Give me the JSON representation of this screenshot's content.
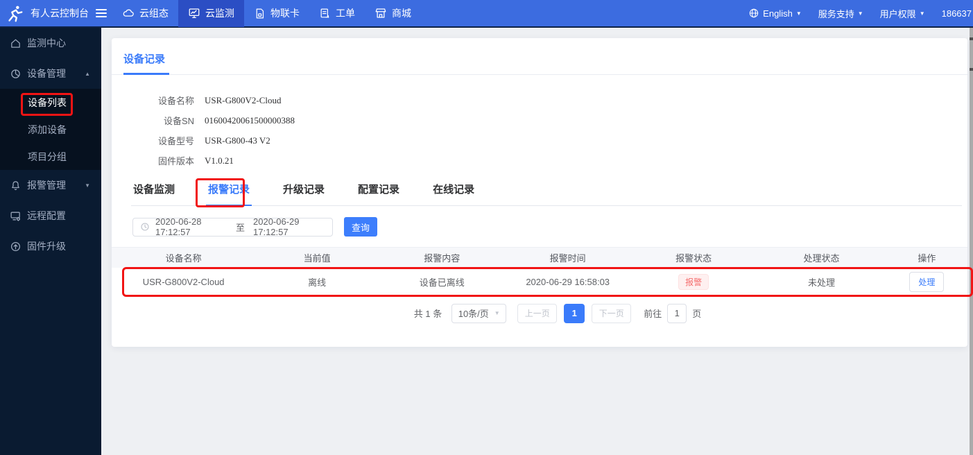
{
  "colors": {
    "topbar": "#3C6CE0",
    "topbar_active": "#2B4EC4",
    "sidebar": "#0A1B31",
    "accent": "#3A7BFA",
    "danger": "#F56C6C",
    "annotation": "#F11414"
  },
  "topbar": {
    "brand": "有人云控制台",
    "nav": [
      {
        "label": "云组态",
        "icon": "cloud-icon"
      },
      {
        "label": "云监测",
        "icon": "monitor-icon",
        "active": true
      },
      {
        "label": "物联卡",
        "icon": "sim-card-icon"
      },
      {
        "label": "工单",
        "icon": "ticket-icon"
      },
      {
        "label": "商城",
        "icon": "store-icon"
      }
    ],
    "language": "English",
    "support": "服务支持",
    "permissions": "用户权限",
    "account": "186637"
  },
  "sidebar": {
    "items": [
      {
        "label": "监测中心",
        "icon": "home-icon"
      },
      {
        "label": "设备管理",
        "icon": "device-icon",
        "expanded": true
      },
      {
        "label": "设备列表",
        "active": true
      },
      {
        "label": "添加设备"
      },
      {
        "label": "项目分组"
      },
      {
        "label": "报警管理",
        "icon": "bell-icon",
        "expanded": false
      },
      {
        "label": "远程配置",
        "icon": "remote-config-icon"
      },
      {
        "label": "固件升级",
        "icon": "firmware-upgrade-icon"
      }
    ]
  },
  "page": {
    "title": "设备记录",
    "details": [
      {
        "label": "设备名称",
        "value": "USR-G800V2-Cloud"
      },
      {
        "label": "设备SN",
        "value": "01600420061500000388"
      },
      {
        "label": "设备型号",
        "value": "USR-G800-43 V2"
      },
      {
        "label": "固件版本",
        "value": "V1.0.21"
      }
    ],
    "tabs": [
      {
        "label": "设备监测"
      },
      {
        "label": "报警记录",
        "active": true
      },
      {
        "label": "升级记录"
      },
      {
        "label": "配置记录"
      },
      {
        "label": "在线记录"
      }
    ],
    "filter": {
      "start": "2020-06-28 17:12:57",
      "to": "至",
      "end": "2020-06-29 17:12:57",
      "query": "查询"
    },
    "table": {
      "headers": [
        "设备名称",
        "当前值",
        "报警内容",
        "报警时间",
        "报警状态",
        "处理状态",
        "操作"
      ],
      "row": {
        "name": "USR-G800V2-Cloud",
        "current": "离线",
        "content": "设备已离线",
        "time": "2020-06-29 16:58:03",
        "alarm_status": "报警",
        "handle_status": "未处理",
        "action": "处理"
      }
    },
    "pagination": {
      "total": "共 1 条",
      "size": "10条/页",
      "prev": "上一页",
      "current": "1",
      "next": "下一页",
      "goto": "前往",
      "goto_value": "1",
      "unit": "页"
    }
  }
}
